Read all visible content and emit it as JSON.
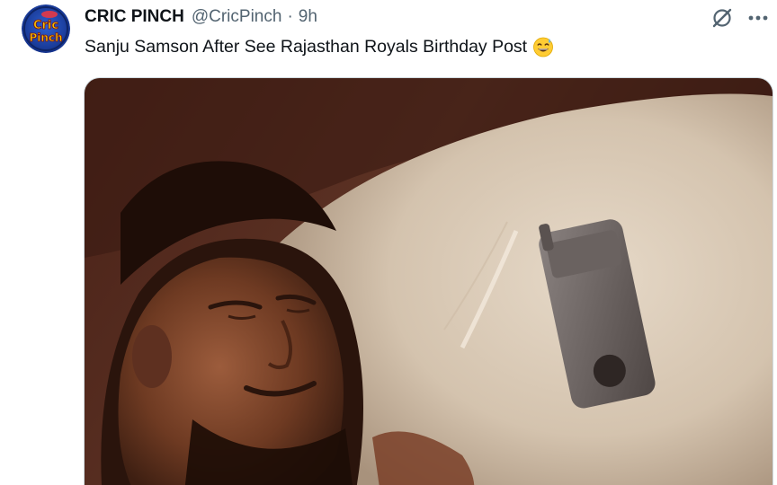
{
  "tweet": {
    "author": {
      "display_name": "CRIC PINCH",
      "handle": "@CricPinch",
      "avatar_text_top": "Cric",
      "avatar_text_bottom": "Pinch"
    },
    "separator": "·",
    "time": "9h",
    "text": "Sanju Samson After See Rajasthan Royals Birthday Post",
    "emoji": "grinning-face-with-sweat-emoji",
    "icons": [
      "grok-icon",
      "more-icon"
    ],
    "media": {
      "kind": "image",
      "subject": "man lying on a pillow beside a phone"
    }
  },
  "colors": {
    "text_primary": "#0f1419",
    "text_secondary": "#536471",
    "avatar_bg": "#1d3f9e",
    "avatar_text": "#f5c400",
    "border": "#cfd9de"
  }
}
